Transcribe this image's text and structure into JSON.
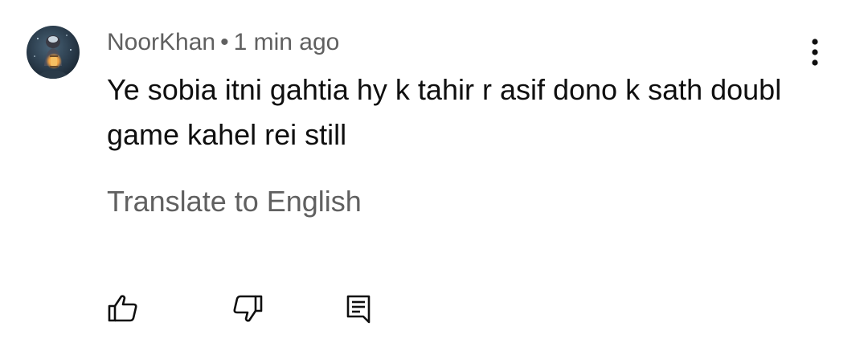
{
  "comment": {
    "author": "NoorKhan",
    "separator": "•",
    "timestamp": "1 min ago",
    "text": "Ye sobia itni gahtia hy k tahir r asif dono k sath doubl game kahel rei still",
    "translate_label": "Translate to English"
  },
  "icons": {
    "avatar": "profile-photo",
    "more": "vertical-ellipsis-icon",
    "like": "thumbs-up-icon",
    "dislike": "thumbs-down-icon",
    "reply": "comment-icon"
  },
  "colors": {
    "primary_text": "#0f0f0f",
    "secondary_text": "#606060",
    "icon": "#0f0f0f"
  }
}
